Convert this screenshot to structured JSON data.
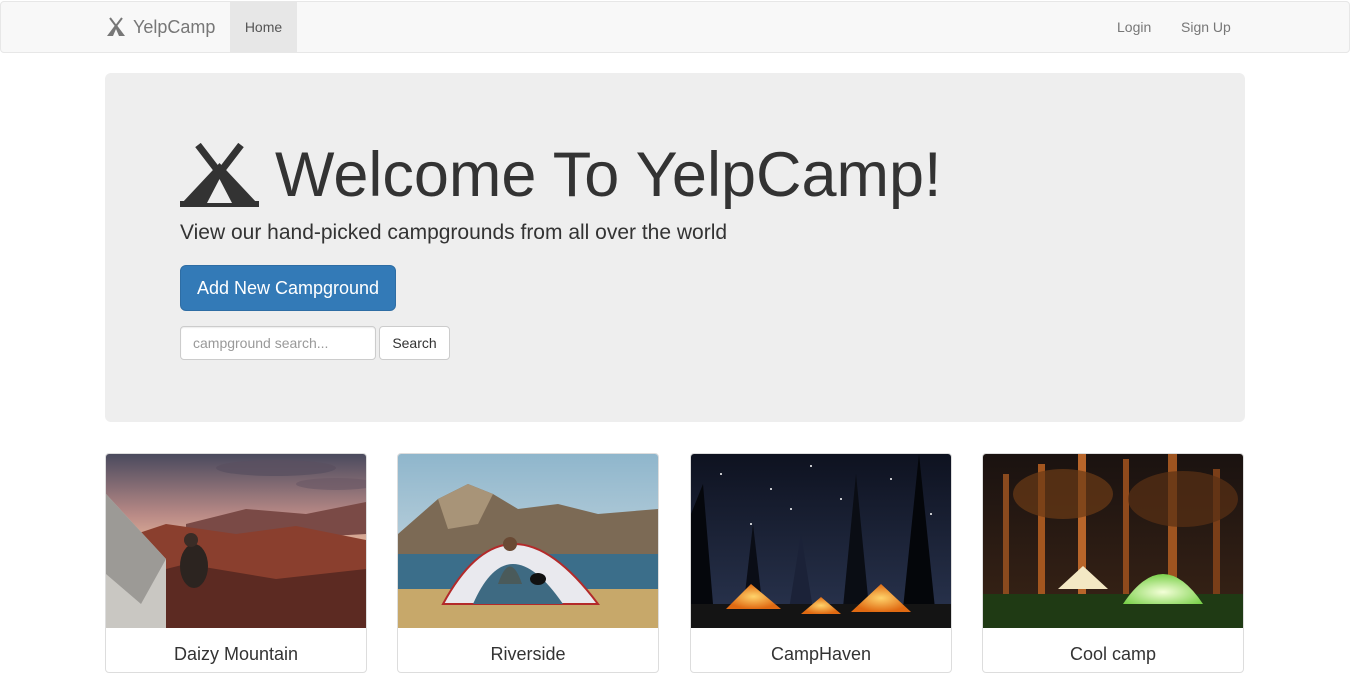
{
  "nav": {
    "brand": "YelpCamp",
    "home": "Home",
    "login": "Login",
    "signup": "Sign Up"
  },
  "jumbotron": {
    "title": "Welcome To YelpCamp!",
    "lead": "View our hand-picked campgrounds from all over the world",
    "add_button": "Add New Campground",
    "search_placeholder": "campground search...",
    "search_button": "Search"
  },
  "campgrounds": [
    {
      "name": "Daizy Mountain",
      "image": "tent-at-sunset-over-red-canyon"
    },
    {
      "name": "Riverside",
      "image": "person-in-tent-by-mountain-lake"
    },
    {
      "name": "CampHaven",
      "image": "orange-tents-under-starry-night-forest"
    },
    {
      "name": "Cool camp",
      "image": "glowing-tents-in-night-forest"
    }
  ],
  "colors": {
    "navbar_bg": "#f8f8f8",
    "jumbotron_bg": "#eeeeee",
    "primary": "#337ab7"
  },
  "icons": {
    "brand": "tent-icon",
    "title": "tent-icon"
  }
}
